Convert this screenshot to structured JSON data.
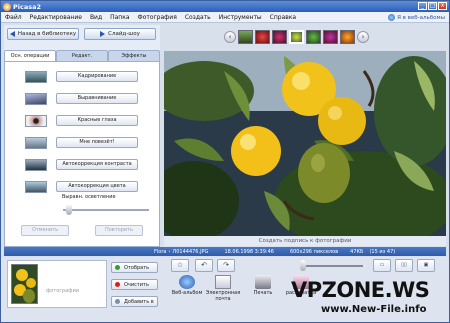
{
  "window": {
    "title": "Picasa2",
    "minimize": "_",
    "maximize": "□",
    "close": "x"
  },
  "menu": [
    "Файл",
    "Редактирование",
    "Вид",
    "Папка",
    "Фотография",
    "Создать",
    "Инструменты",
    "Справка"
  ],
  "weblink": "Я в веб-альбомы",
  "left": {
    "back_button": "Назад в библиотеку",
    "slideshow_button": "Слайд-шоу",
    "tabs": [
      "Осн. операции",
      "Редакт.",
      "Эффекты"
    ],
    "operations": [
      "Кадрирование",
      "Выравнивание",
      "Красные глаза",
      "Мне повезёт!",
      "Автокоррекция контраста",
      "Автокоррекция цвета"
    ],
    "fill_light_label": "Выравн. осветление",
    "undo": "Отменить",
    "redo": "Повторить"
  },
  "caption_placeholder": "Создать подпись к фотографии",
  "status": {
    "folder": "Flora",
    "file": "Л0144476.JPG",
    "date": "18.06.1998 3:39:46",
    "dimensions": "600x296 пикселов",
    "size": "47КБ",
    "position": "(15 из 47)"
  },
  "tray": {
    "label": "фотографии",
    "show_button": "Отобрать",
    "clear_button": "Очистить",
    "add_button": "Добавить в"
  },
  "toolbar": {
    "star": "☆",
    "rotate_left": "↶",
    "rotate_right": "↷",
    "web_album": "Веб-альбом",
    "email": "Электронная почта",
    "print": "Печать",
    "export": "распечатка"
  },
  "watermark": {
    "main": "VPZONE.WS",
    "sub": "www.New-File.info"
  },
  "colors": {
    "titlebar": "#2b5eb8",
    "statusbar": "#2e5aa8",
    "accent_red": "#d62020",
    "accent_green": "#2fa033"
  }
}
